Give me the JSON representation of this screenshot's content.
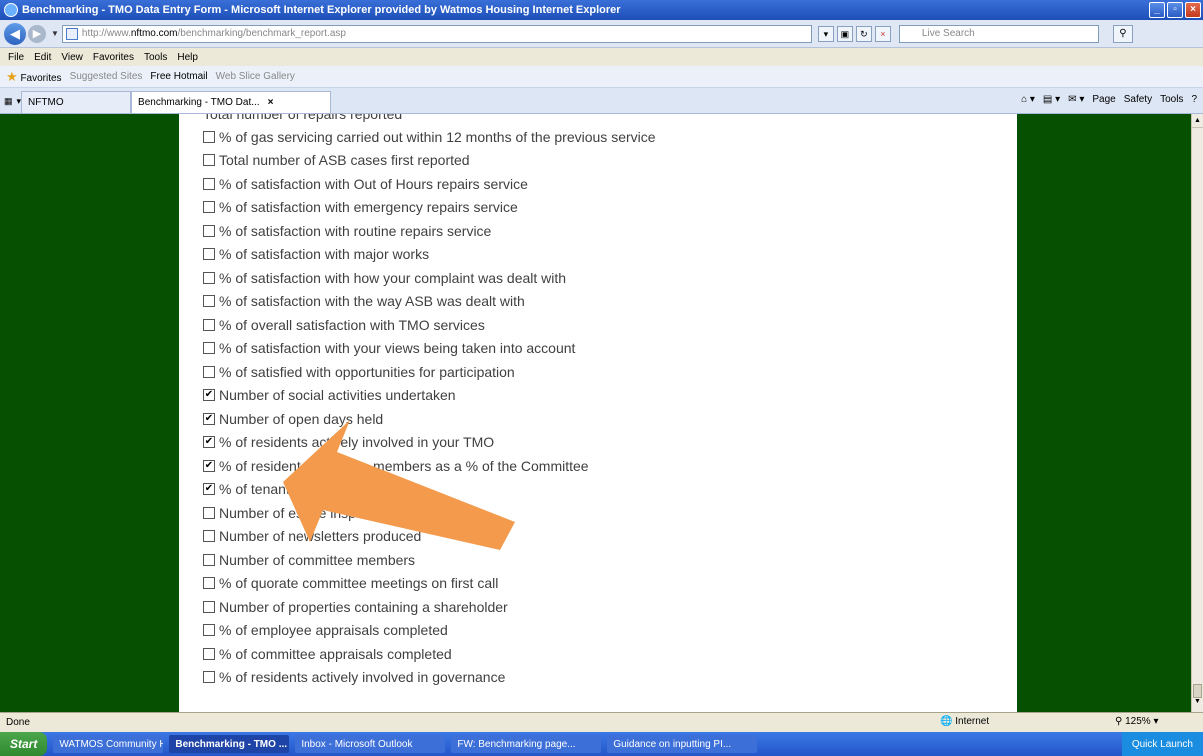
{
  "window": {
    "title": "Benchmarking - TMO Data Entry Form - Microsoft Internet Explorer provided by Watmos Housing Internet Explorer"
  },
  "address_bar": {
    "url_prefix": "http://www.",
    "url_domain": "nftmo.com",
    "url_path": "/benchmarking/benchmark_report.asp",
    "search_placeholder": "Live Search"
  },
  "menu": [
    "File",
    "Edit",
    "View",
    "Favorites",
    "Tools",
    "Help"
  ],
  "favorites_bar": {
    "favorites_label": "Favorites",
    "suggested_sites": "Suggested Sites",
    "free_hotmail": "Free Hotmail",
    "web_slice": "Web Slice Gallery"
  },
  "tabs": {
    "first": "NFTMO",
    "active": "Benchmarking - TMO Dat...",
    "tools": [
      "Page",
      "Safety",
      "Tools"
    ]
  },
  "form": {
    "cut_off_item": "Total number of repairs reported",
    "items": [
      {
        "label": "% of gas servicing carried out within 12 months of the previous service",
        "checked": false
      },
      {
        "label": "Total number of ASB cases first reported",
        "checked": false
      },
      {
        "label": "% of satisfaction with Out of Hours repairs service",
        "checked": false
      },
      {
        "label": "% of satisfaction with emergency repairs service",
        "checked": false
      },
      {
        "label": "% of satisfaction with routine repairs service",
        "checked": false
      },
      {
        "label": "% of satisfaction with major works",
        "checked": false
      },
      {
        "label": "% of satisfaction with how your complaint was dealt with",
        "checked": false
      },
      {
        "label": "% of satisfaction with the way ASB was dealt with",
        "checked": false
      },
      {
        "label": "% of overall satisfaction with TMO services",
        "checked": false
      },
      {
        "label": "% of satisfaction with your views being taken into account",
        "checked": false
      },
      {
        "label": "% of satisfied with opportunities for participation",
        "checked": false
      },
      {
        "label": "Number of social activities undertaken",
        "checked": true
      },
      {
        "label": "Number of open days held",
        "checked": true
      },
      {
        "label": "% of residents actively involved in your TMO",
        "checked": true
      },
      {
        "label": "% of resident committee members as a % of the Committee",
        "checked": true
      },
      {
        "label": "% of tenant",
        "checked": true
      },
      {
        "label": "Number of estate inspections completed",
        "checked": false
      },
      {
        "label": "Number of newsletters produced",
        "checked": false
      },
      {
        "label": "Number of committee members",
        "checked": false
      },
      {
        "label": "% of quorate committee meetings on first call",
        "checked": false
      },
      {
        "label": "Number of properties containing a shareholder",
        "checked": false
      },
      {
        "label": "% of employee appraisals completed",
        "checked": false
      },
      {
        "label": "% of committee appraisals completed",
        "checked": false
      },
      {
        "label": "% of residents actively involved in governance",
        "checked": false
      }
    ]
  },
  "status_bar": {
    "status": "Done",
    "zone": "Internet",
    "zoom": "125%"
  },
  "taskbar": {
    "start": "Start",
    "buttons": [
      {
        "label": "WATMOS Community Ho...",
        "active": false
      },
      {
        "label": "Benchmarking - TMO ...",
        "active": true
      },
      {
        "label": "Inbox - Microsoft Outlook",
        "active": false
      },
      {
        "label": "FW: Benchmarking page...",
        "active": false
      },
      {
        "label": "Guidance on inputting PI...",
        "active": false
      }
    ],
    "quick_launch": "Quick Launch"
  },
  "colors": {
    "page_background": "#055001",
    "arrow": "#f39a4c"
  }
}
